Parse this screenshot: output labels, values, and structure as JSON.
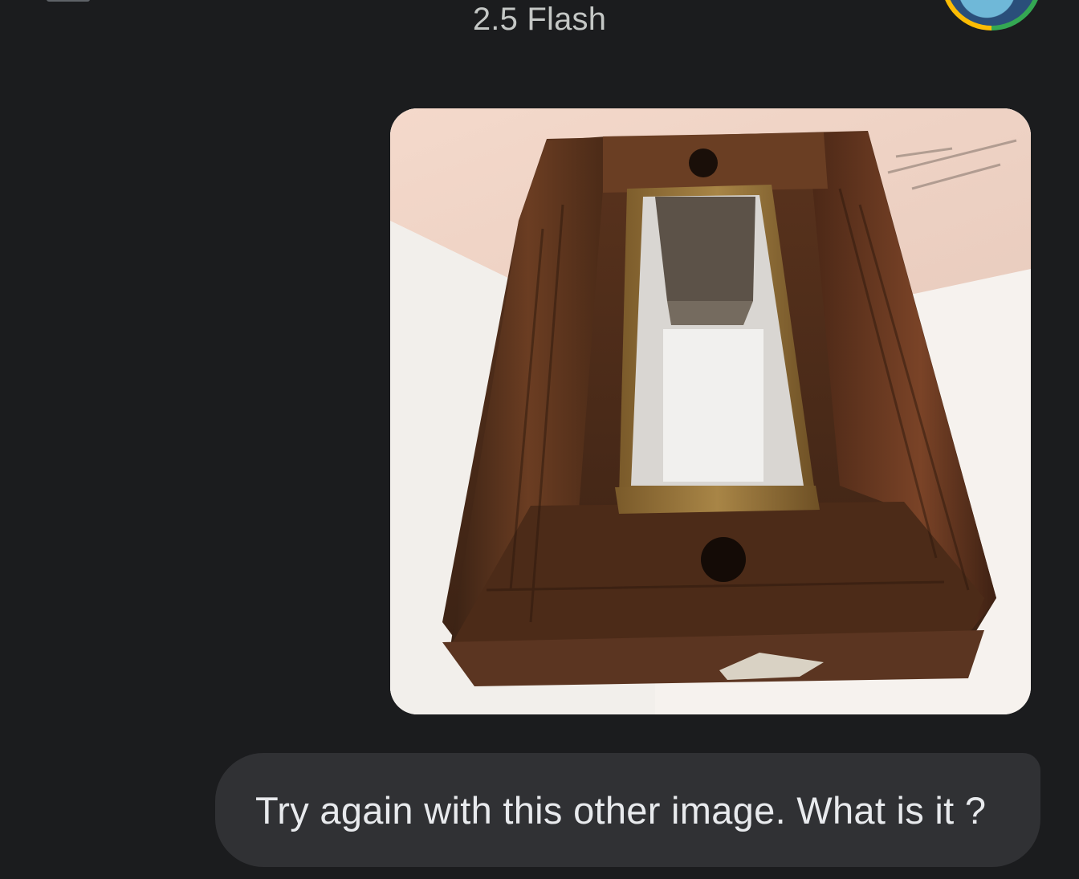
{
  "header": {
    "model_name": "2.5 Flash"
  },
  "chat": {
    "user_message": "Try again with this other image. What is it ?"
  },
  "icons": {
    "menu": "menu-icon",
    "avatar": "user-avatar"
  },
  "colors": {
    "background": "#1b1c1e",
    "bubble": "#303134",
    "title_text": "#c4c7c5",
    "message_text": "#e8eaed"
  }
}
